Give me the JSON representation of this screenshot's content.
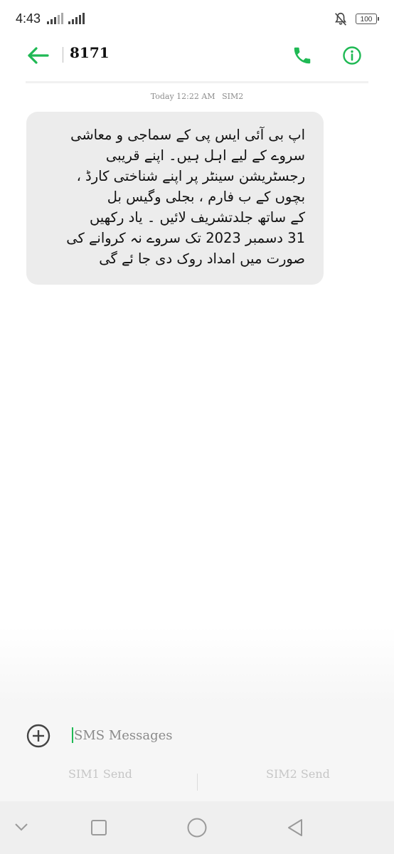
{
  "status_bar": {
    "time": "4:43",
    "battery": "100"
  },
  "header": {
    "title": "8171"
  },
  "message": {
    "date": "Today 12:22 AM",
    "sim": "SIM2",
    "body": "اپ بی آئی ایس پی کے  سماجی و معاشی\nسروے کے لیے اہل ہیں۔ اپنے قریبی\nرجسٹریشن سینٹر پر اپنے شناختی کارڈ ،\nبچوں کے ب فارم ، بجلی وگیس  بل\nکے ساتھ     جلدتشریف لائیں ۔ یاد رکھیں\n31 دسمبر  2023 تک  سروے  نہ کروانے کی\nصورت میں  امداد روک دی جا  ئے گی"
  },
  "composer": {
    "placeholder": "SMS Messages",
    "sim1_send": "SIM1 Send",
    "sim2_send": "SIM2 Send"
  },
  "colors": {
    "accent": "#1fb954",
    "bubble": "#ececec"
  },
  "icons": [
    "back-arrow-icon",
    "phone-icon",
    "info-icon",
    "add-icon",
    "mute-icon"
  ]
}
